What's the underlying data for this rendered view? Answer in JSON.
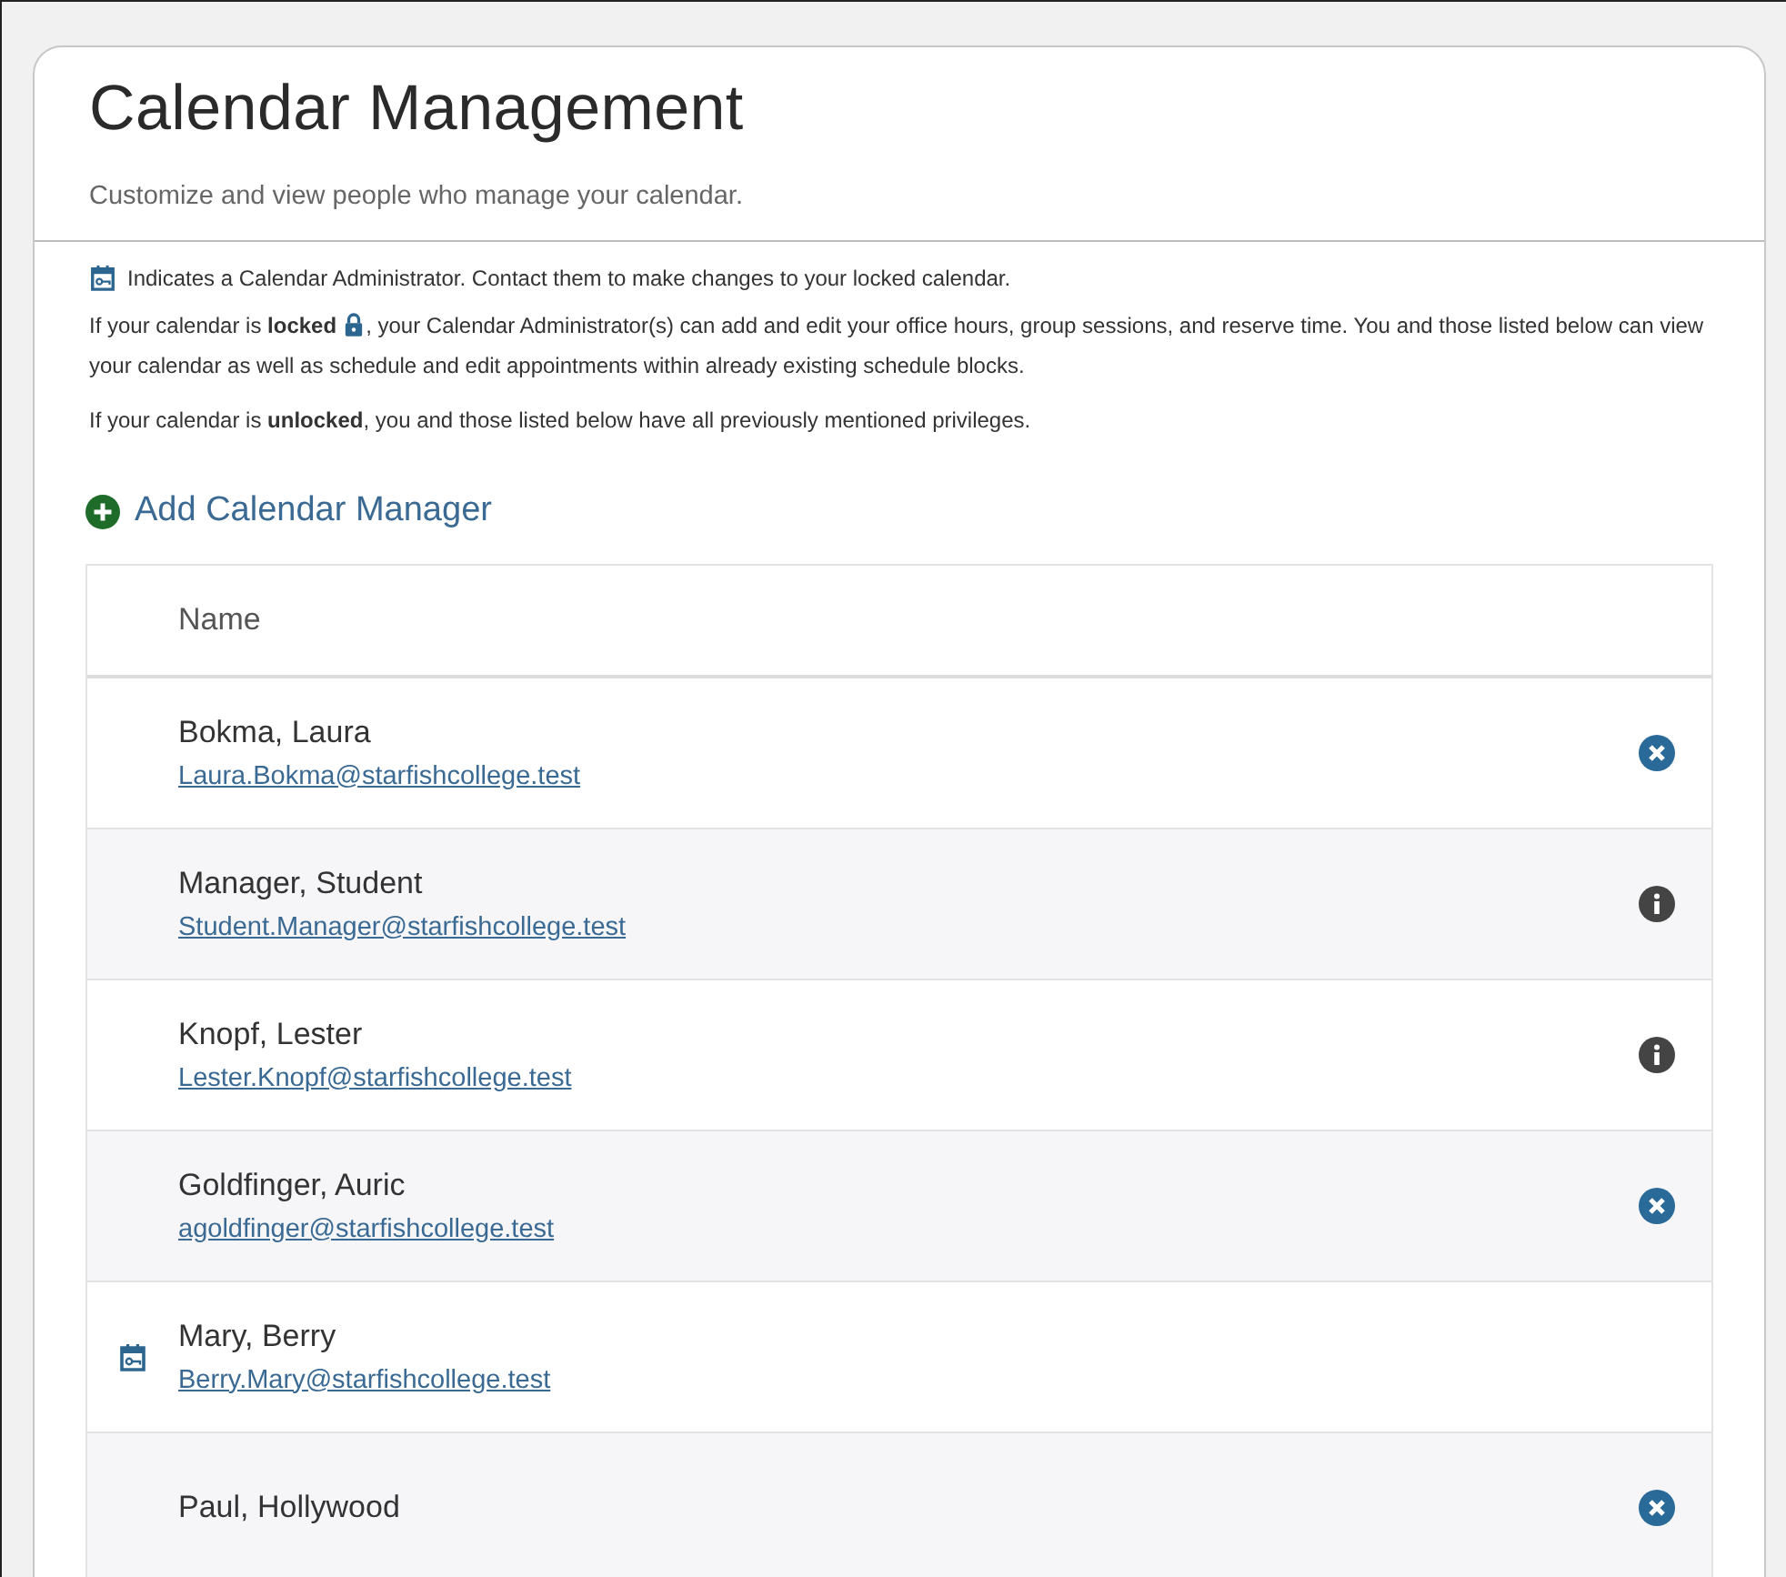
{
  "title": "Calendar Management",
  "subtitle": "Customize and view people who manage your calendar.",
  "legend": "Indicates a Calendar Administrator. Contact them to make changes to your locked calendar.",
  "locked_note": {
    "before": "If your calendar is **locked**",
    "after": ", your Calendar Administrator(s) can add and edit your office hours, group sessions, and reserve time. You and those listed below can view your calendar as well as schedule and edit appointments within already existing schedule blocks."
  },
  "unlocked_note": "If your calendar is **unlocked**, you and those listed below have all previously mentioned privileges.",
  "add_link": "Add Calendar Manager",
  "table": {
    "columns": [
      "Name"
    ],
    "rows": [
      {
        "name": "Bokma, Laura",
        "email": "Laura.Bokma@starfishcollege.test",
        "admin": false,
        "kind": "remove"
      },
      {
        "name": "Manager, Student",
        "email": "Student.Manager@starfishcollege.test",
        "admin": false,
        "kind": "info"
      },
      {
        "name": "Knopf, Lester",
        "email": "Lester.Knopf@starfishcollege.test",
        "admin": false,
        "kind": "info"
      },
      {
        "name": "Goldfinger, Auric",
        "email": "agoldfinger@starfishcollege.test",
        "admin": false,
        "kind": "remove"
      },
      {
        "name": "Mary, Berry",
        "email": "Berry.Mary@starfishcollege.test",
        "admin": true,
        "kind": "none"
      },
      {
        "name": "Paul, Hollywood",
        "admin": false,
        "kind": "remove"
      }
    ]
  }
}
